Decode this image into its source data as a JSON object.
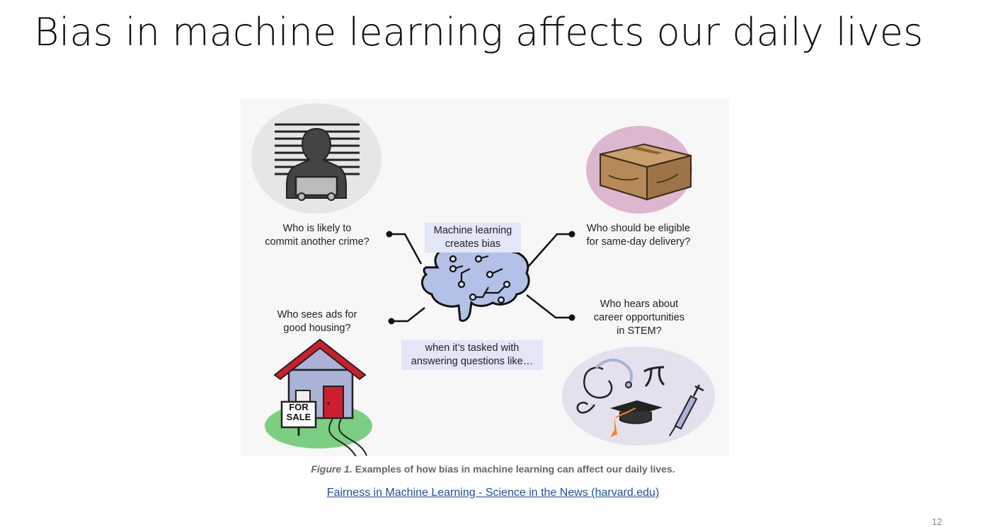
{
  "slide": {
    "title": "Bias in machine learning affects our daily lives",
    "page_number": "12"
  },
  "figure": {
    "center_top_label": [
      "Machine learning",
      "creates bias"
    ],
    "center_bottom_label": [
      "when it’s tasked with",
      "answering questions like…"
    ],
    "questions": {
      "crime": [
        "Who is likely to",
        "commit another crime?"
      ],
      "delivery": [
        "Who should be eligible",
        "for same-day delivery?"
      ],
      "housing": [
        "Who sees ads for",
        "good housing?"
      ],
      "stem": [
        "Who hears about",
        "career opportunities",
        "in STEM?"
      ]
    },
    "sign_text": [
      "FOR",
      "SALE"
    ],
    "caption_prefix": "Figure 1.",
    "caption_text": " Examples of how bias in machine learning can affect our daily lives."
  },
  "source_link": "Fairness in Machine Learning - Science in the News (harvard.edu)",
  "colors": {
    "brain": "#b3c1e8",
    "label_bg": "#e2e6f7",
    "crime_circle": "#e6e6e6",
    "delivery_circle": "#dcb7cf",
    "stem_circle": "#e4e0ee",
    "house_roof": "#cc1f2d",
    "house_grass": "#7ccf82",
    "box": "#b58a58",
    "link": "#1f4e9c"
  }
}
